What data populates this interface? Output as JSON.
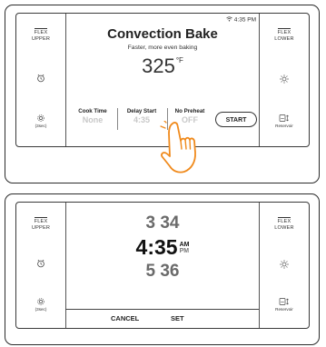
{
  "side_left": {
    "flex_label_1": "FLEX",
    "flex_label_2": "UPPER",
    "timer_icon": "timer-icon",
    "settings_icon": "settings-gear-icon",
    "settings_caption": "(3sec)"
  },
  "side_right": {
    "flex_label_1": "FLEX",
    "flex_label_2": "LOWER",
    "light_icon": "light-icon",
    "reservoir_icon": "reservoir-icon",
    "reservoir_caption": "Reservoir"
  },
  "screen1": {
    "clock": "4:35 PM",
    "wifi_icon": "wifi-icon",
    "mode_title": "Convection Bake",
    "mode_subtitle": "Faster, more even baking",
    "temperature": "325",
    "temperature_unit": "°F",
    "cook_time_label": "Cook Time",
    "cook_time_value": "None",
    "delay_start_label": "Delay Start",
    "delay_start_value": "4:35",
    "no_preheat_label": "No Preheat",
    "no_preheat_value": "OFF",
    "start_label": "START",
    "hand_icon": "pointing-hand-icon"
  },
  "screen2": {
    "hour_prev": "3",
    "minute_prev": "34",
    "hour_current": "4",
    "separator": ":",
    "minute_current": "35",
    "am_label": "AM",
    "pm_label": "PM",
    "hour_next": "5",
    "minute_next": "36",
    "cancel_label": "CANCEL",
    "set_label": "SET"
  },
  "colors": {
    "outline": "#2b2b2b",
    "hand_fill": "#ffffff",
    "hand_stroke": "#f08a1c",
    "inactive_value": "#c8c8c8"
  }
}
